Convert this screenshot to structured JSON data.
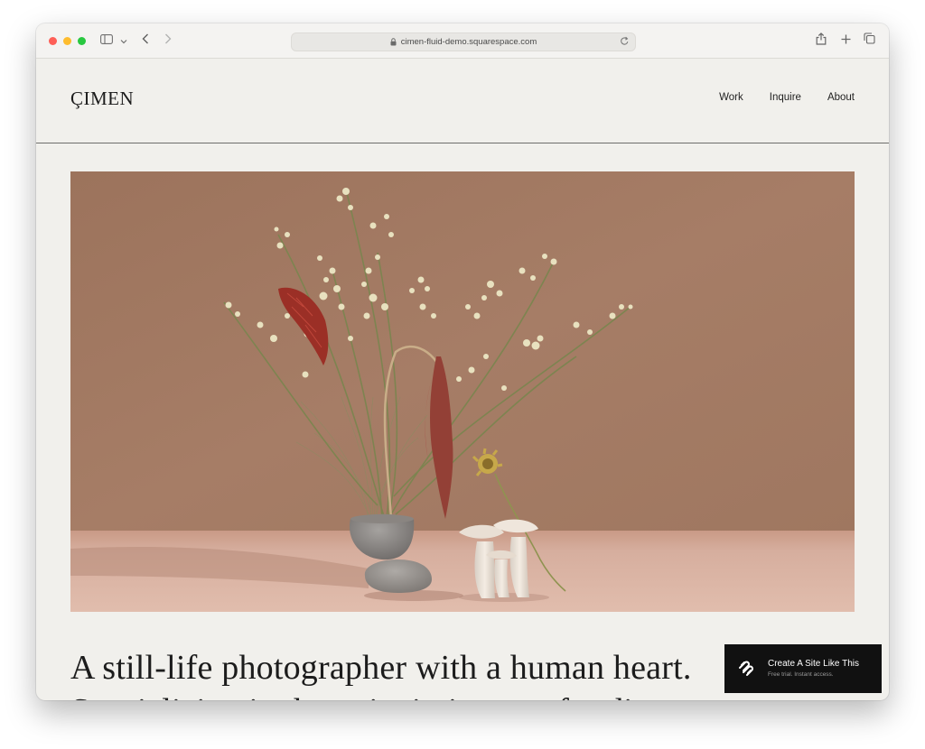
{
  "browser": {
    "url": "cimen-fluid-demo.squarespace.com",
    "icons": [
      "sidebar-icon",
      "chevron-down-icon",
      "back-icon",
      "forward-icon",
      "lock-icon",
      "reload-icon",
      "share-icon",
      "new-tab-icon",
      "tabs-icon"
    ]
  },
  "site": {
    "logo": "ÇIMEN",
    "nav": [
      {
        "label": "Work"
      },
      {
        "label": "Inquire"
      },
      {
        "label": "About"
      }
    ]
  },
  "hero": {
    "headline": "A still-life photographer with a human heart.",
    "headline_line2": "Specializing in the quiet intimacy of ordinary"
  },
  "badge": {
    "title": "Create A Site Like This",
    "subtitle": "Free trial. Instant access."
  },
  "colors": {
    "page_bg": "#f1f0ec",
    "photo_wall": "#a0775f",
    "photo_floor": "#d9b3a4",
    "badge_bg": "#111111"
  }
}
